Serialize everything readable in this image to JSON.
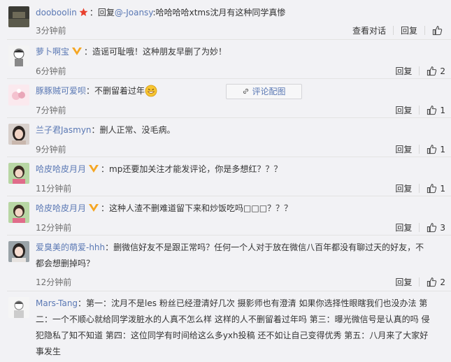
{
  "actions": {
    "view_conversation": "查看对话",
    "reply": "回复"
  },
  "comments": [
    {
      "user": "dooboolin",
      "badge": "star",
      "prefix": "：回复",
      "mention": "@-Joansy",
      "text": ":哈哈哈哈xtms沈月有这种同学真惨",
      "time": "3分钟前",
      "likes": ""
    },
    {
      "user": "萝卜啊宝",
      "badge": "vip",
      "text": "：造谣可耻哦！这种朋友早删了为妙！",
      "pic_button": "评论配图",
      "time": "6分钟前",
      "likes": "2"
    },
    {
      "user": "豚豚贼可爱呗",
      "text": "：不删留着过年",
      "emoji": "grin-emoji",
      "time": "7分钟前",
      "likes": "1"
    },
    {
      "user": "兰子君Jasmyn",
      "text": "：删人正常、没毛病。",
      "time": "9分钟前",
      "likes": "1"
    },
    {
      "user": "哈皮哈皮月月",
      "badge": "vip",
      "text": "：mp还要加关注才能发评论，你是多想红？？？",
      "time": "11分钟前",
      "likes": "1"
    },
    {
      "user": "哈皮哈皮月月",
      "badge": "vip",
      "text": "：这种人渣不删难道留下来和炒饭吃吗□□□？？？",
      "time": "12分钟前",
      "likes": "3"
    },
    {
      "user": "爱臭美的萌爱-hhh",
      "text": "：删微信好友不是跟正常吗？任何一个人对于放在微信八百年都没有聊过天的好友，不都会想删掉吗？",
      "time": "12分钟前",
      "likes": "2"
    },
    {
      "user": "Mars-Tang",
      "text": "：第一：沈月不是les 粉丝已经澄清好几次 摄影师也有澄清 如果你选择性眼瞎我们也没办法 第二：一个不顺心就给同学泼脏水的人真不怎么样 这样的人不删留着过年吗 第三：曝光微信号是认真的吗 侵犯隐私了知不知道 第四：这位同学有时间给这么多yxh投稿 还不如让自己变得优秀 第五：八月来了大家好事发生",
      "time": "",
      "likes": ""
    }
  ]
}
